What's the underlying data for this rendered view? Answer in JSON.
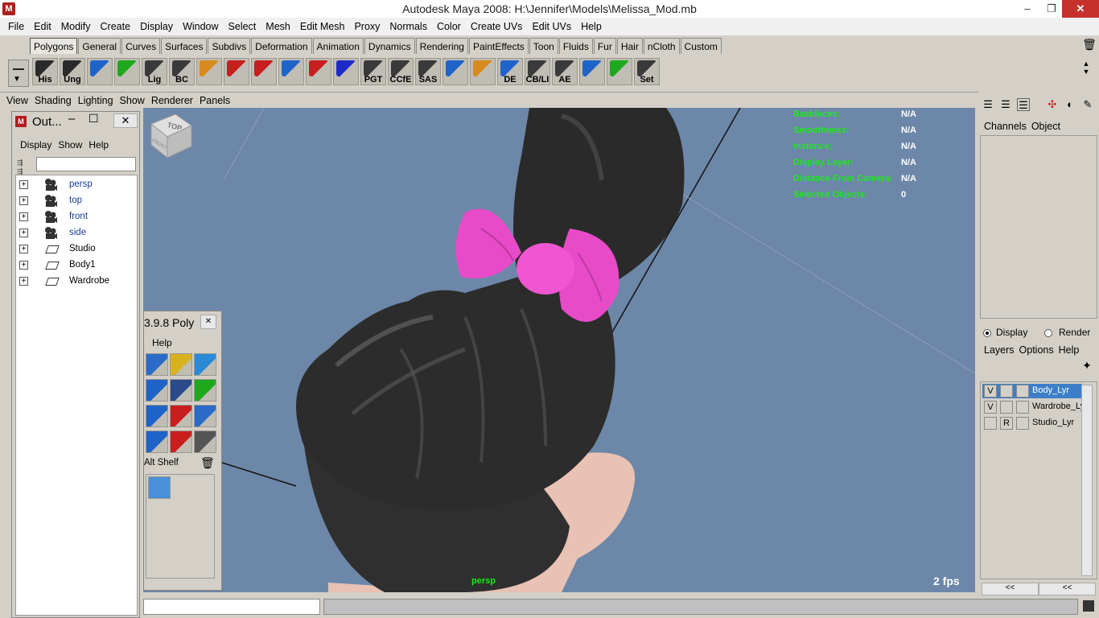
{
  "window": {
    "title": "Autodesk Maya 2008: H:\\Jennifer\\Models\\Melissa_Mod.mb",
    "app_icon": "maya-logo-icon",
    "controls": [
      "minimize",
      "maximize",
      "close"
    ]
  },
  "menubar": [
    "File",
    "Edit",
    "Modify",
    "Create",
    "Display",
    "Window",
    "Select",
    "Mesh",
    "Edit Mesh",
    "Proxy",
    "Normals",
    "Color",
    "Create UVs",
    "Edit UVs",
    "Help"
  ],
  "shelf_tabs": [
    "Polygons",
    "General",
    "Curves",
    "Surfaces",
    "Subdivs",
    "Deformation",
    "Animation",
    "Dynamics",
    "Rendering",
    "PaintEffects",
    "Toon",
    "Fluids",
    "Fur",
    "Hair",
    "nCloth",
    "Custom"
  ],
  "active_shelf_tab": "Polygons",
  "shelf_icons": [
    {
      "label": "His",
      "icon": "history-icon",
      "color": "#2a2a2a"
    },
    {
      "label": "Ung",
      "icon": "ungroup-icon",
      "color": "#2a2a2a"
    },
    {
      "label": "",
      "icon": "cube-select-icon",
      "color": "#1e63c8"
    },
    {
      "label": "",
      "icon": "sphere-paint-icon",
      "color": "#1ea81e"
    },
    {
      "label": "Lig",
      "icon": "light-icon",
      "color": "#3a3a3a"
    },
    {
      "label": "BC",
      "icon": "bevel-icon",
      "color": "#3a3a3a"
    },
    {
      "label": "",
      "icon": "move-tool-icon",
      "color": "#d88a1e"
    },
    {
      "label": "",
      "icon": "undo-red-icon",
      "color": "#c81e1e"
    },
    {
      "label": "",
      "icon": "gear-tool-icon",
      "color": "#c81e1e"
    },
    {
      "label": "",
      "icon": "grid-tool-icon",
      "color": "#1e63c8"
    },
    {
      "label": "",
      "icon": "axis-tool-icon",
      "color": "#c81e1e"
    },
    {
      "label": "",
      "icon": "curve-tool-icon",
      "color": "#1e2ac8"
    },
    {
      "label": "PGT",
      "icon": "pgt-icon",
      "color": "#3a3a3a"
    },
    {
      "label": "CCfE",
      "icon": "ccfe-icon",
      "color": "#3a3a3a"
    },
    {
      "label": "SAS",
      "icon": "sas-icon",
      "color": "#3a3a3a"
    },
    {
      "label": "",
      "icon": "plane-blue-icon",
      "color": "#1e63c8"
    },
    {
      "label": "",
      "icon": "uv-grid-icon",
      "color": "#d88a1e"
    },
    {
      "label": "DE",
      "icon": "de-icon",
      "color": "#1e63c8"
    },
    {
      "label": "CB/LI",
      "icon": "cb-icon",
      "color": "#3a3a3a"
    },
    {
      "label": "AE",
      "icon": "ae-icon",
      "color": "#3a3a3a"
    },
    {
      "label": "",
      "icon": "cylinder-icon",
      "color": "#1e63c8"
    },
    {
      "label": "",
      "icon": "pipe-tool-icon",
      "color": "#1ea81e"
    },
    {
      "label": "Set",
      "icon": "key-set-icon",
      "color": "#3a3a3a"
    }
  ],
  "panel_menu": [
    "View",
    "Shading",
    "Lighting",
    "Show",
    "Renderer",
    "Panels"
  ],
  "hud": [
    {
      "label": "Backfaces:",
      "value": "N/A"
    },
    {
      "label": "Smoothness:",
      "value": "N/A"
    },
    {
      "label": "Instance:",
      "value": "N/A"
    },
    {
      "label": "Display Layer:",
      "value": "N/A"
    },
    {
      "label": "Distance From Camera:",
      "value": "N/A"
    },
    {
      "label": "Selected Objects:",
      "value": "0"
    }
  ],
  "viewport": {
    "camera_label": "persp",
    "fps": "2 fps",
    "viewcube": {
      "top": "TOP",
      "front": "FRONT"
    },
    "colors": {
      "background": "#6d87a8",
      "hair": "#2b2b2b",
      "bow": "#e84bc8",
      "skin": "#e8c2b4"
    }
  },
  "outliner": {
    "title": "Out...",
    "menu": [
      "Display",
      "Show",
      "Help"
    ],
    "items": [
      {
        "name": "persp",
        "type": "camera"
      },
      {
        "name": "top",
        "type": "camera"
      },
      {
        "name": "front",
        "type": "camera"
      },
      {
        "name": "side",
        "type": "camera"
      },
      {
        "name": "Studio",
        "type": "set"
      },
      {
        "name": "Body1",
        "type": "set"
      },
      {
        "name": "Wardrobe",
        "type": "set"
      }
    ]
  },
  "poly_shelf": {
    "title": "3.9.8 Poly",
    "help": "Help",
    "alt_shelf": "Alt Shelf",
    "icons": [
      "plane-icon",
      "uv-tool-icon",
      "extrude-icon",
      "cube-blue-icon",
      "building-icon",
      "grass-icon",
      "cut-icon",
      "split-icon",
      "sphere-tool-icon",
      "cube-small-icon",
      "arrows-tool-icon",
      "camera-tool-icon"
    ]
  },
  "channel_box": {
    "menu": [
      "Channels",
      "Object"
    ],
    "radio": [
      {
        "label": "Display",
        "selected": true
      },
      {
        "label": "Render",
        "selected": false
      }
    ],
    "layer_menu": [
      "Layers",
      "Options",
      "Help"
    ],
    "layers": [
      {
        "v": "V",
        "p": "",
        "name": "Body_Lyr",
        "selected": true
      },
      {
        "v": "V",
        "p": "",
        "name": "Wardrobe_Ly",
        "selected": false
      },
      {
        "v": "",
        "p": "R",
        "name": "Studio_Lyr",
        "selected": false
      }
    ],
    "nav": [
      "<<",
      "<<"
    ]
  }
}
